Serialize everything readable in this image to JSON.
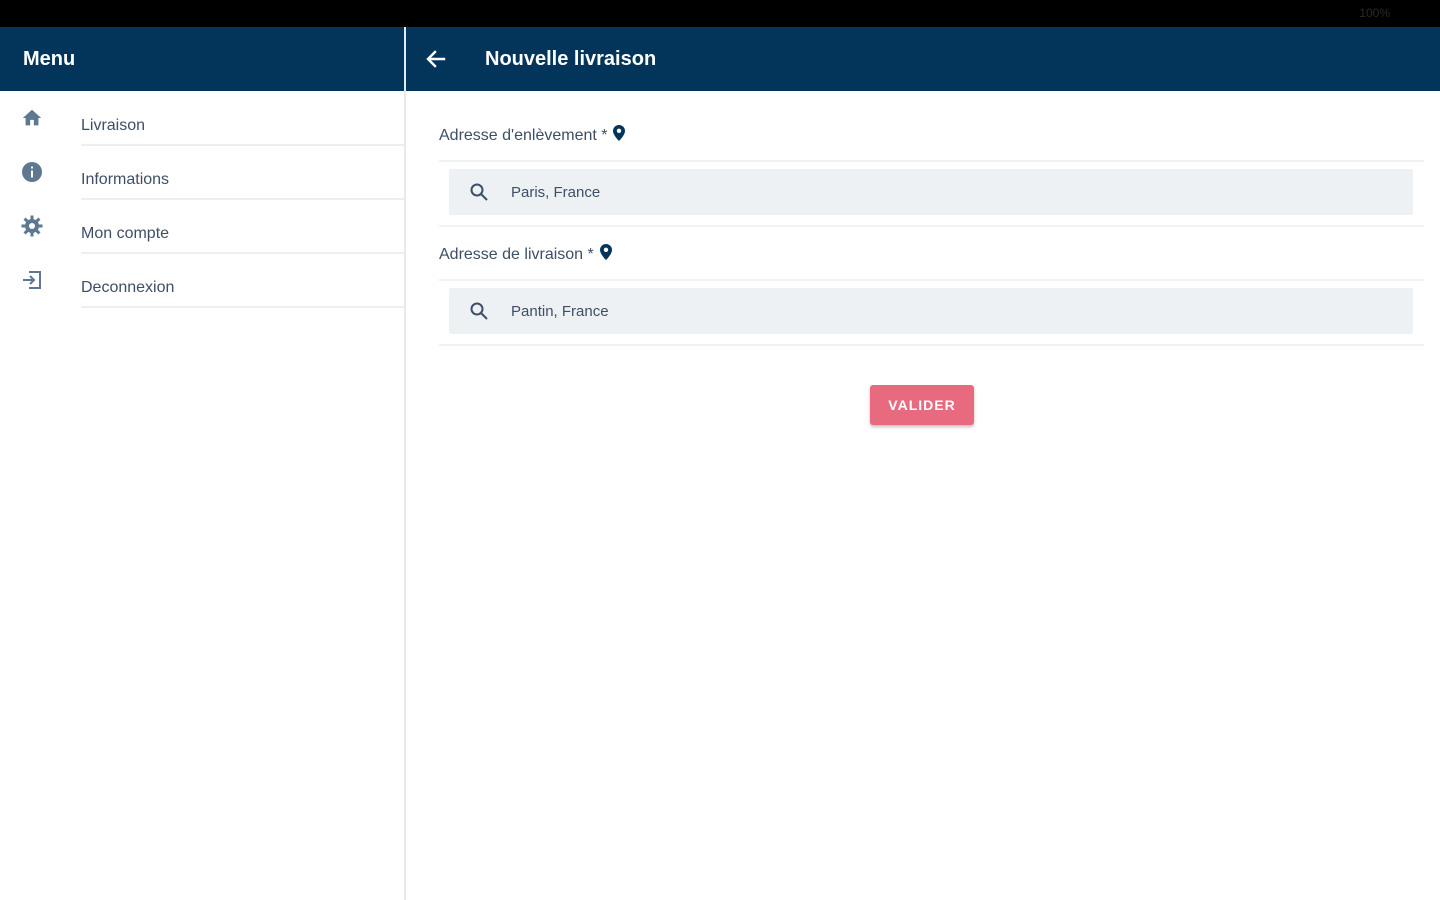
{
  "status_bar": {
    "battery_text": "100%"
  },
  "sidebar": {
    "title": "Menu",
    "items": [
      {
        "label": "Livraison",
        "icon": "home-icon"
      },
      {
        "label": "Informations",
        "icon": "info-icon"
      },
      {
        "label": "Mon compte",
        "icon": "gear-icon"
      },
      {
        "label": "Deconnexion",
        "icon": "logout-icon"
      }
    ]
  },
  "main": {
    "title": "Nouvelle livraison",
    "pickup": {
      "label": "Adresse d'enlèvement *",
      "value": "Paris, France",
      "icon": "location-pin-icon"
    },
    "delivery": {
      "label": "Adresse de livraison *",
      "value": "Pantin, France",
      "icon": "location-pin-icon"
    },
    "submit_label": "VALIDER"
  },
  "colors": {
    "header_bg": "#03345a",
    "accent_button": "#e86a7f",
    "input_bg": "#eef1f4",
    "icon": "#5e7891"
  }
}
